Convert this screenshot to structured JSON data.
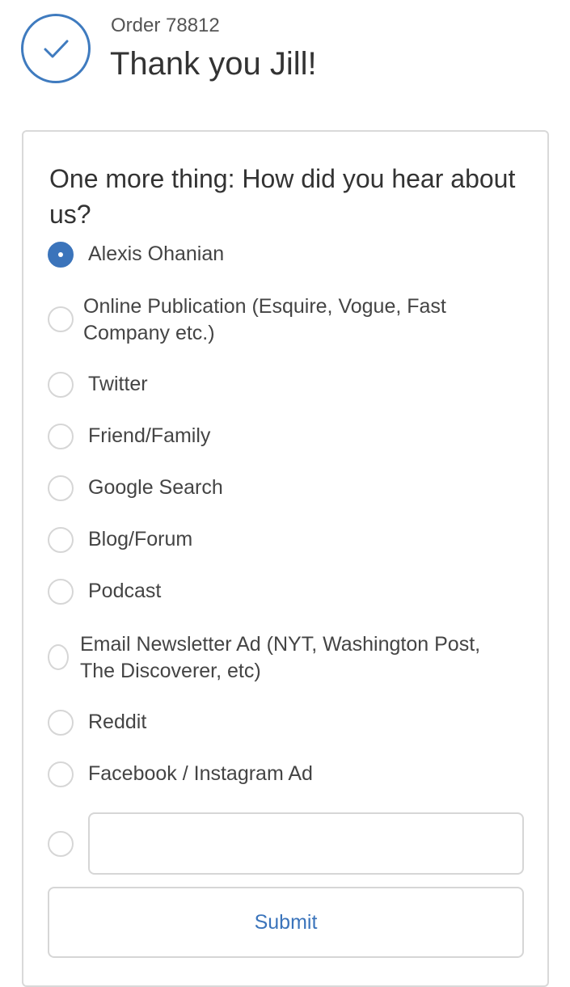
{
  "header": {
    "order_label": "Order 78812",
    "title": "Thank you Jill!"
  },
  "survey": {
    "question": "One more thing: How did you hear about us?",
    "selected_option": "Alexis Ohanian",
    "options": [
      {
        "label_lines": [
          "Alexis Ohanian"
        ],
        "checked": true
      },
      {
        "label_lines": [
          "Online Publication (Esquire, Vogue, Fast",
          "Company etc.)"
        ],
        "checked": false
      },
      {
        "label_lines": [
          "Twitter"
        ],
        "checked": false
      },
      {
        "label_lines": [
          "Friend/Family"
        ],
        "checked": false
      },
      {
        "label_lines": [
          "Google Search"
        ],
        "checked": false
      },
      {
        "label_lines": [
          "Blog/Forum"
        ],
        "checked": false
      },
      {
        "label_lines": [
          "Podcast"
        ],
        "checked": false
      },
      {
        "label_lines": [
          "Email Newsletter Ad (NYT, Washington Post,",
          "The Discoverer, etc)"
        ],
        "checked": false
      },
      {
        "label_lines": [
          "Reddit"
        ],
        "checked": false
      },
      {
        "label_lines": [
          "Facebook / Instagram Ad"
        ],
        "checked": false
      }
    ],
    "other_option": {
      "checked": false,
      "value": "",
      "placeholder": ""
    },
    "submit_label": "Submit"
  },
  "colors": {
    "accent": "#3b74bb",
    "border": "#d6d6d6",
    "text": "#333333"
  }
}
